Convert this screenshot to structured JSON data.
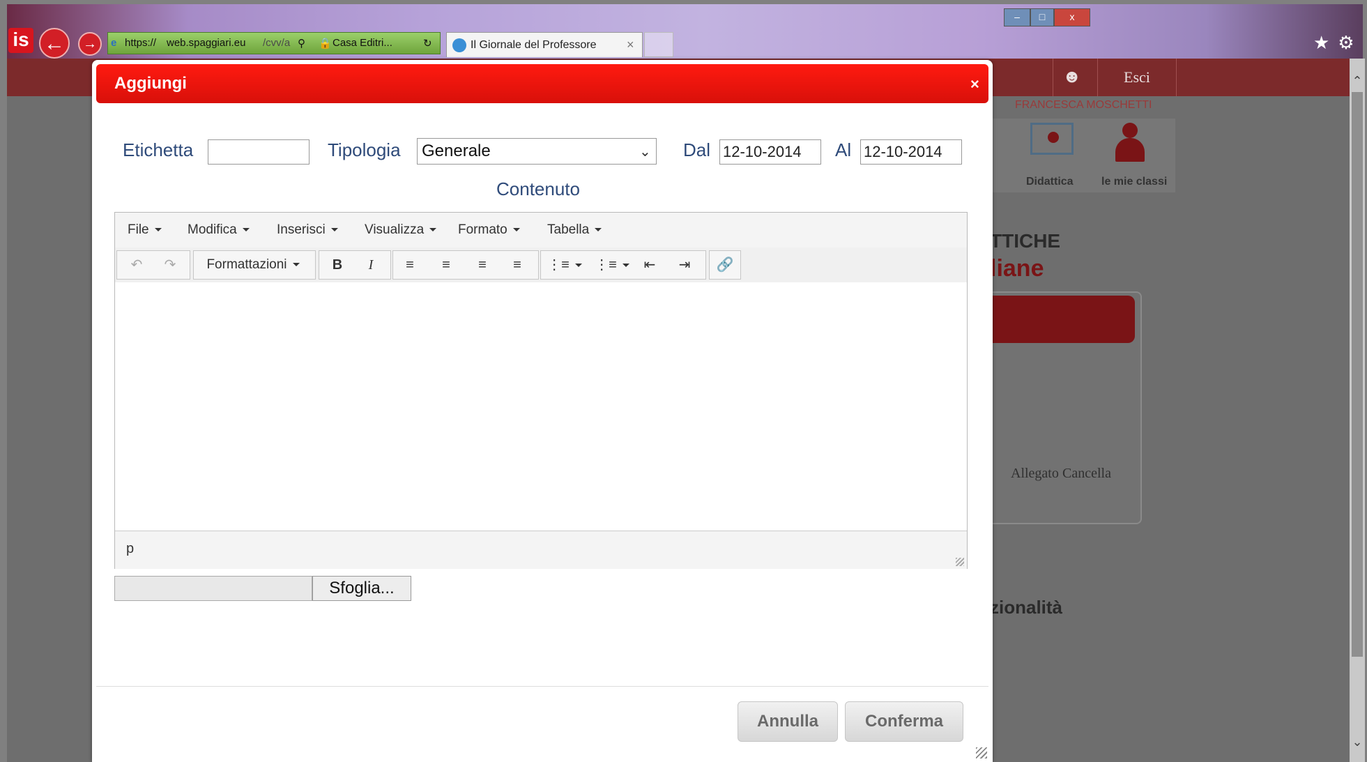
{
  "browser": {
    "address_parts": [
      "https://",
      "web.spaggiari.eu",
      "/cvv/a"
    ],
    "second_addr": "Casa Editri...",
    "tab_title": "Il Giornale del Professore",
    "tab_close": "×",
    "logo": "is"
  },
  "background_page": {
    "logout": "Esci",
    "user_name": "FRANCESCA MOSCHETTI",
    "menu": [
      {
        "label": "Didattica"
      },
      {
        "label": "le mie classi"
      }
    ],
    "heading_partial": "TTICHE",
    "subheading_partial": "liane",
    "actions": [
      "Allegato",
      "Cancella"
    ],
    "section_partial": "zionalità"
  },
  "modal": {
    "title": "Aggiungi",
    "close": "×",
    "fields": {
      "etichetta_label": "Etichetta",
      "etichetta_value": "",
      "tipologia_label": "Tipologia",
      "tipologia_value": "Generale",
      "dal_label": "Dal",
      "dal_value": "12-10-2014",
      "al_label": "Al",
      "al_value": "12-10-2014",
      "contenuto_label": "Contenuto"
    },
    "editor": {
      "menus": [
        "File",
        "Modifica",
        "Inserisci",
        "Visualizza",
        "Formato",
        "Tabella"
      ],
      "format_dropdown": "Formattazioni",
      "bold": "B",
      "italic": "I",
      "status_path": "p"
    },
    "browse_button": "Sfoglia...",
    "cancel_button": "Annulla",
    "confirm_button": "Conferma"
  },
  "colors": {
    "modal_header": "#e8140c",
    "label_blue": "#2f4b7a",
    "app_red": "#7c2a2b"
  }
}
